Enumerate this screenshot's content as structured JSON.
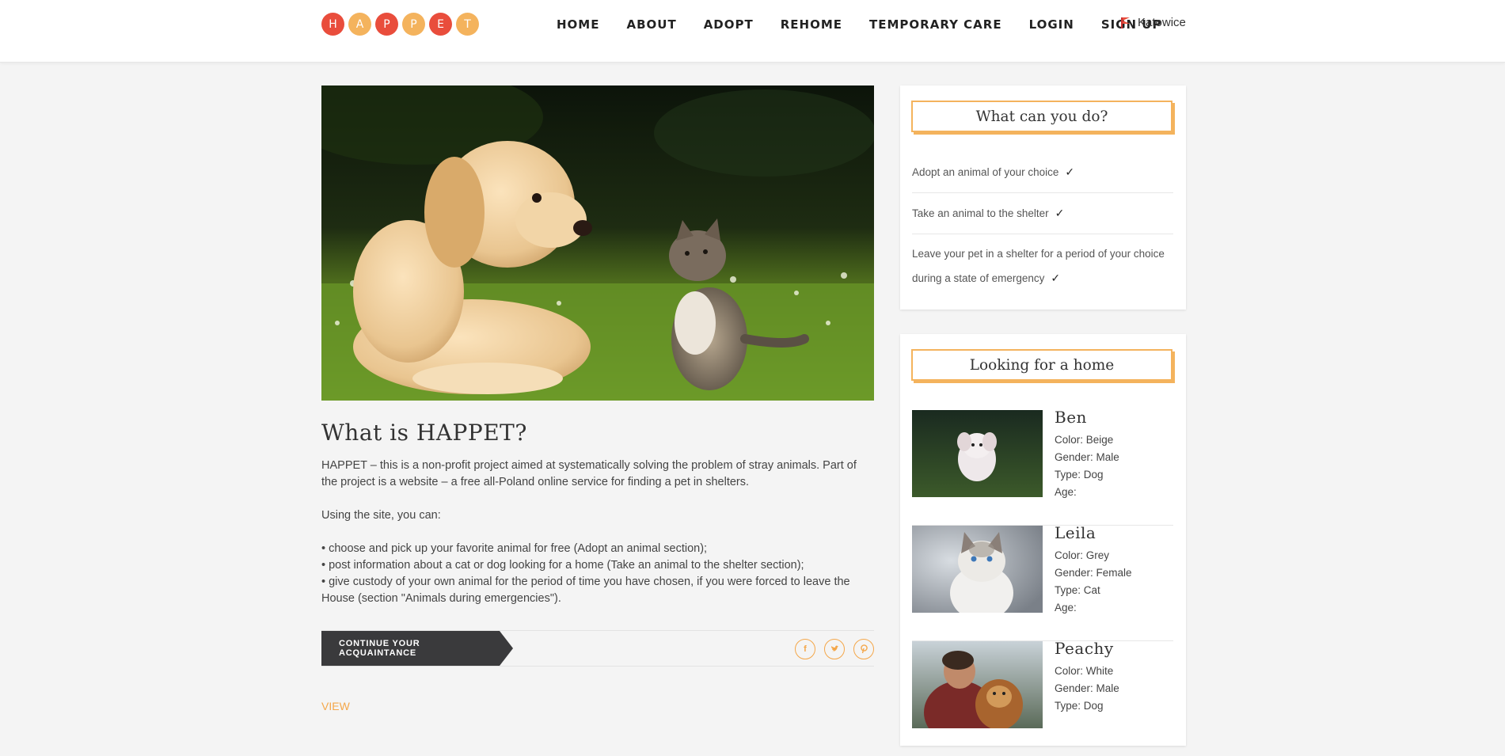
{
  "header": {
    "logo_letters": [
      "H",
      "A",
      "P",
      "P",
      "E",
      "T"
    ],
    "nav": [
      "HOME",
      "ABOUT",
      "ADOPT",
      "REHOME",
      "TEMPORARY CARE",
      "LOGIN",
      "SIGN UP"
    ],
    "location": "Katowice"
  },
  "colors": {
    "accent": "#f4a74a",
    "logo_red": "#e94d3c",
    "logo_gold": "#f4b35d",
    "button_dark": "#3a3a3c"
  },
  "main": {
    "title": "What is HAPPET?",
    "intro": "HAPPET – this is a non-profit project aimed at systematically solving the problem of stray animals. Part of the project is a website – a free all-Poland online service for finding a pet in shelters.",
    "using_site": "Using the site, you can:",
    "bullets": [
      "• choose and pick up your favorite animal for free (Adopt an animal section);",
      "• post information about a cat or dog looking for a home (Take an animal to the shelter section);",
      "• give custody of your own animal for the period of time you have chosen, if you were forced to leave the House (section \"Animals during emergencies\")."
    ],
    "continue_label": "CONTINUE YOUR ACQUAINTANCE",
    "social_icons": [
      "facebook-icon",
      "twitter-icon",
      "pinterest-icon"
    ],
    "view_label": "VIEW"
  },
  "sidebar": {
    "todo": {
      "heading": "What can you do?",
      "items": [
        "Adopt an animal of your choice",
        "Take an animal to the shelter",
        "Leave your pet in a shelter for a period of your choice during a state of emergency"
      ],
      "check": "✓"
    },
    "home": {
      "heading": "Looking for a home",
      "pets": [
        {
          "name": "Ben",
          "color": "Color: Beige",
          "gender": "Gender: Male",
          "type": "Type: Dog",
          "age": "Age:"
        },
        {
          "name": "Leila",
          "color": "Color: Grey",
          "gender": "Gender: Female",
          "type": "Type: Cat",
          "age": "Age:"
        },
        {
          "name": "Peachy",
          "color": "Color: White",
          "gender": "Gender: Male",
          "type": "Type: Dog",
          "age": ""
        }
      ]
    }
  }
}
